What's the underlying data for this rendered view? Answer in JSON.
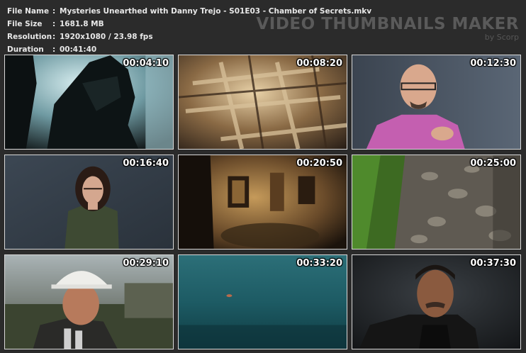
{
  "info": {
    "file_name_label": "File Name",
    "file_name": "Mysteries Unearthed with Danny Trejo - S01E03 - Chamber of Secrets.mkv",
    "file_size_label": "File Size",
    "file_size": "1681.8 MB",
    "resolution_label": "Resolution",
    "resolution": "1920x1080 / 23.98 fps",
    "duration_label": "Duration",
    "duration": "00:41:40",
    "separator": ":"
  },
  "brand": {
    "title": "VIDEO THUMBNAILS MAKER",
    "subtitle": "by Scorp"
  },
  "thumbnails": [
    {
      "timestamp": "00:04:10"
    },
    {
      "timestamp": "00:08:20"
    },
    {
      "timestamp": "00:12:30"
    },
    {
      "timestamp": "00:16:40"
    },
    {
      "timestamp": "00:20:50"
    },
    {
      "timestamp": "00:25:00"
    },
    {
      "timestamp": "00:29:10"
    },
    {
      "timestamp": "00:33:20"
    },
    {
      "timestamp": "00:37:30"
    }
  ],
  "colors": {
    "background": "#2b2b2b",
    "text": "#e8e8e8",
    "brand": "#5a5a5a",
    "thumb_border": "#d9d9d9"
  }
}
